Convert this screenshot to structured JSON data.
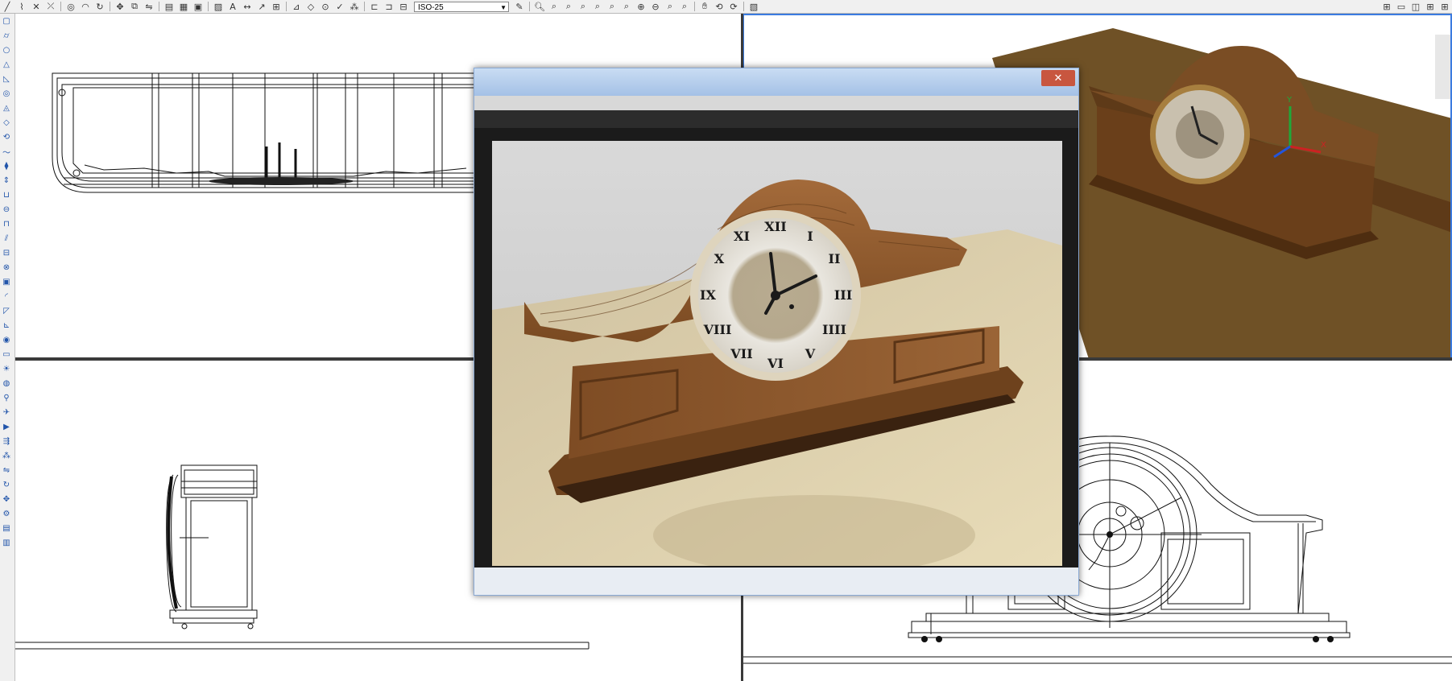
{
  "toolbar": {
    "dimension_style": "ISO-25",
    "icons": [
      "line-icon",
      "polyline-icon",
      "trim-icon",
      "extend-icon",
      "circle-icon",
      "arc-icon",
      "move-icon",
      "copy-icon",
      "layer-icon",
      "properties-icon",
      "block-icon",
      "hatch-icon",
      "text-icon",
      "dimension-icon",
      "zoom-icon",
      "pan-icon",
      "orbit-icon",
      "render-icon"
    ]
  },
  "left_toolbar": {
    "icons": [
      "box-icon",
      "cylinder-icon",
      "sphere-icon",
      "cone-icon",
      "wedge-icon",
      "torus-icon",
      "extrude-icon",
      "revolve-icon",
      "union-icon",
      "subtract-icon",
      "intersect-icon",
      "slice-icon",
      "section-icon",
      "interfere-icon",
      "shell-icon",
      "fillet-icon",
      "chamfer-icon",
      "ucs-icon",
      "view-icon",
      "light-icon"
    ]
  },
  "render_window": {
    "title": "",
    "close_glyph": "✕",
    "status": ""
  },
  "colors": {
    "wood": "#8a5a2e",
    "wood_dark": "#5a3616",
    "floor": "#dccfa8",
    "iso_floor": "#7a5a2a",
    "viewport_border": "#3b7be0"
  }
}
